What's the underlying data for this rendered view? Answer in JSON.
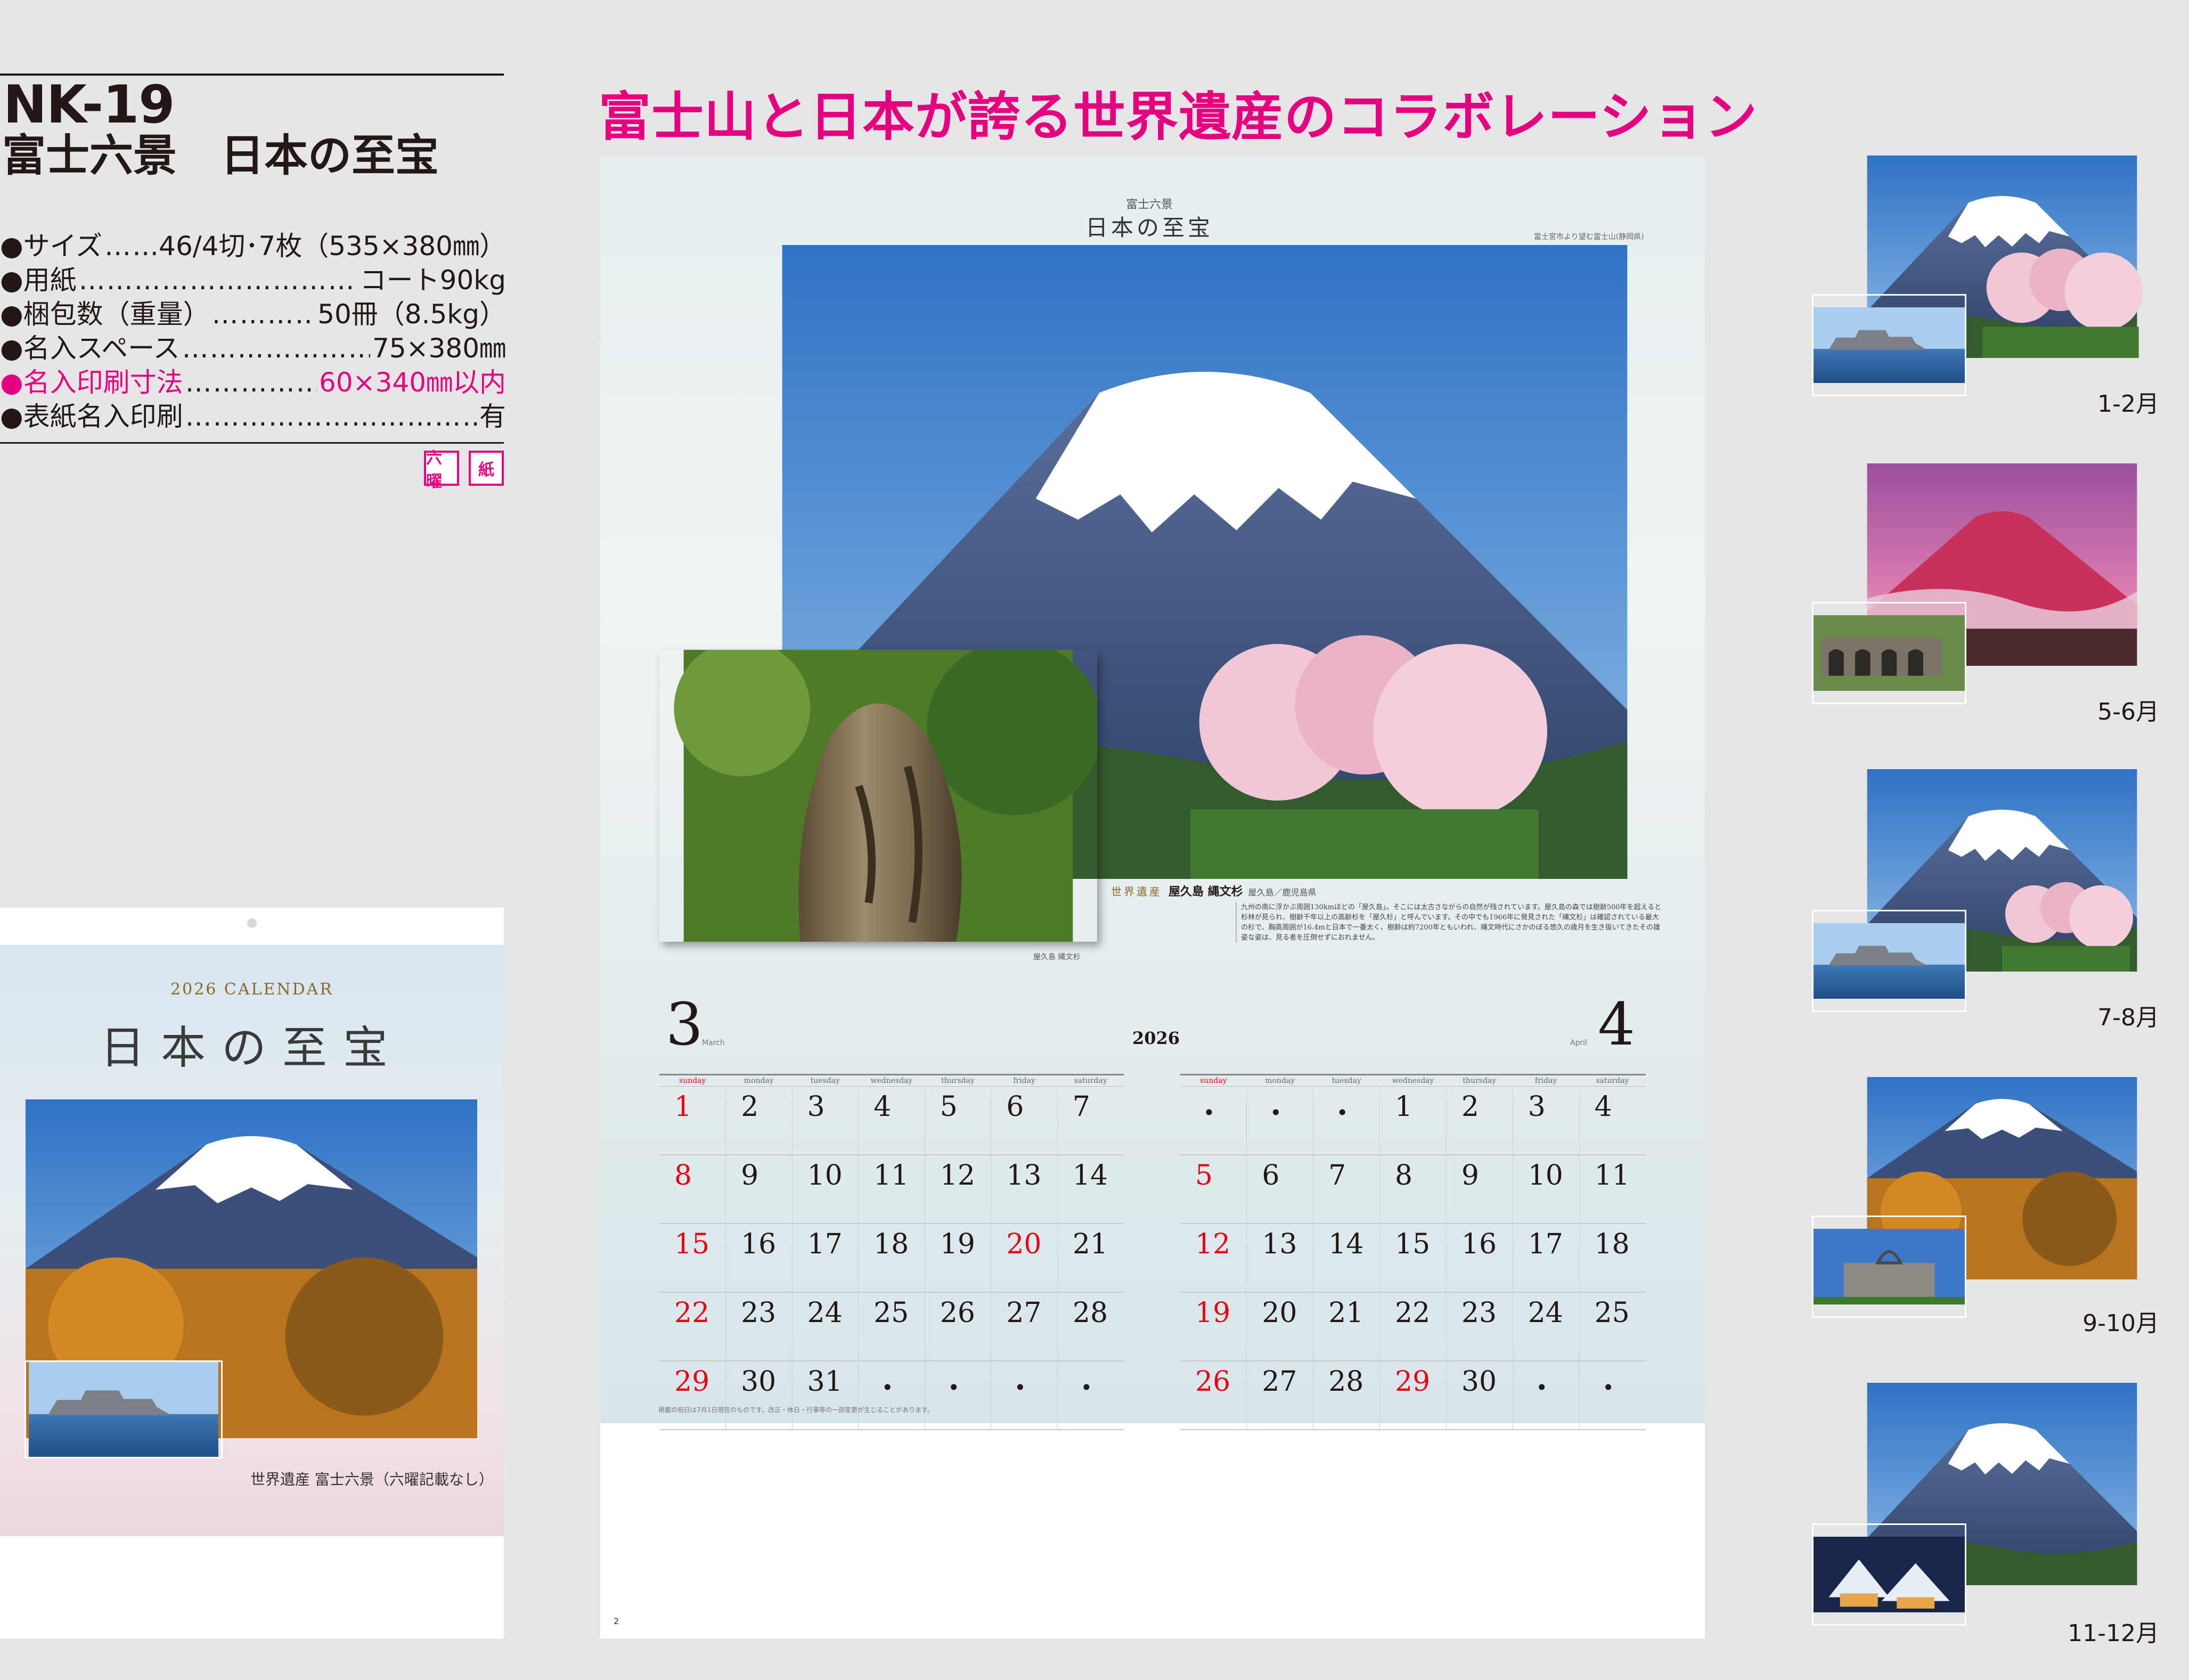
{
  "product": {
    "code": "NK-19",
    "name": "富士六景　日本の至宝"
  },
  "specs": [
    {
      "label": "●サイズ",
      "value": "46/4切･7枚（535×380㎜）",
      "highlight": false
    },
    {
      "label": "●用紙",
      "value": "コート90kg",
      "highlight": false
    },
    {
      "label": "●梱包数（重量）",
      "value": "50冊（8.5kg）",
      "highlight": false
    },
    {
      "label": "●名入スペース",
      "value": "75×380㎜",
      "highlight": false
    },
    {
      "label": "●名入印刷寸法",
      "value": "60×340㎜以内",
      "highlight": true
    },
    {
      "label": "●表紙名入印刷",
      "value": "有",
      "highlight": false
    }
  ],
  "badges": [
    "六曜",
    "紙"
  ],
  "headline": "富士山と日本が誇る世界遺産のコラボレーション",
  "cover": {
    "year_label": "2026 CALENDAR",
    "title": "日本の至宝",
    "caption": "世界遺産 富士六景（六曜記載なし）"
  },
  "spread": {
    "brand_sub": "富士六景",
    "brand": "日本の至宝",
    "photo_caption": "富士宮市より望む富士山(静岡県)",
    "inset_caption": "屋久島 縄文杉",
    "desc_tag": "世界遺産",
    "desc_name": "屋久島 縄文杉",
    "desc_location": "屋久島／鹿児島県",
    "desc_text": "九州の南に浮かぶ周囲130kmほどの「屋久島」。そこには太古さながらの自然が残されています。屋久島の森では樹齢500年を超えると杉林が見られ、樹齢千年以上の高齢杉を「屋久杉」と呼んでいます。その中でも1966年に発見された「縄文杉」は確認されている最大の杉で、胸高周囲が16.4mと日本で一番太く、樹齢は約7200年ともいわれ、縄文時代にさかのぼる悠久の歳月を生き抜いてきたその雄姿な姿は、見る者を圧倒せずにおれません。",
    "year": "2026",
    "page_number": "2",
    "note": "掲載の祝日は7月1日現在のものです。改正・休日・行事等の一部変更が生じることがあります。",
    "weekdays": [
      "sunday",
      "monday",
      "tuesday",
      "wednesday",
      "thursday",
      "friday",
      "saturday"
    ],
    "months": [
      {
        "number": "3",
        "name": "March",
        "weeks": [
          [
            "1",
            "2",
            "3",
            "4",
            "5",
            "6",
            "7"
          ],
          [
            "8",
            "9",
            "10",
            "11",
            "12",
            "13",
            "14"
          ],
          [
            "15",
            "16",
            "17",
            "18",
            "19",
            "20",
            "21"
          ],
          [
            "22",
            "23",
            "24",
            "25",
            "26",
            "27",
            "28"
          ],
          [
            "29",
            "30",
            "31",
            "・",
            "・",
            "・",
            "・"
          ]
        ],
        "holidays": [
          "20"
        ]
      },
      {
        "number": "4",
        "name": "April",
        "weeks": [
          [
            "・",
            "・",
            "・",
            "1",
            "2",
            "3",
            "4"
          ],
          [
            "5",
            "6",
            "7",
            "8",
            "9",
            "10",
            "11"
          ],
          [
            "12",
            "13",
            "14",
            "15",
            "16",
            "17",
            "18"
          ],
          [
            "19",
            "20",
            "21",
            "22",
            "23",
            "24",
            "25"
          ],
          [
            "26",
            "27",
            "28",
            "29",
            "30",
            "・",
            "・"
          ]
        ],
        "holidays": [
          "29"
        ]
      }
    ]
  },
  "thumbnails": [
    {
      "label": "1-2月"
    },
    {
      "label": "5-6月"
    },
    {
      "label": "7-8月"
    },
    {
      "label": "9-10月"
    },
    {
      "label": "11-12月"
    }
  ],
  "colors": {
    "accent": "#e4007f",
    "holiday": "#e60012",
    "text": "#231815",
    "background": "#e5e6e7"
  }
}
